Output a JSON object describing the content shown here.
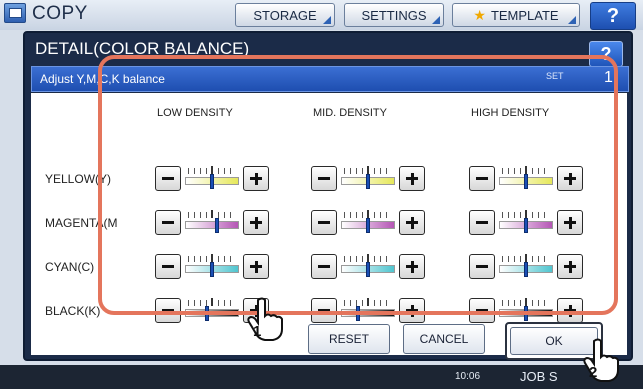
{
  "app": {
    "title": "COPY"
  },
  "top_tabs": [
    {
      "label": "STORAGE"
    },
    {
      "label": "SETTINGS"
    },
    {
      "label": "TEMPLATE"
    }
  ],
  "top_help": "?",
  "dialog": {
    "title": "DETAIL(COLOR BALANCE)",
    "help": "?",
    "subtitle": "Adjust Y,M,C,K balance",
    "set_label": "SET",
    "set_value": "1"
  },
  "columns": [
    "LOW DENSITY",
    "MID. DENSITY",
    "HIGH DENSITY"
  ],
  "rows": [
    {
      "label": "YELLOW(Y)",
      "color": "#e6e85a",
      "levels": [
        0,
        0,
        0
      ]
    },
    {
      "label": "MAGENTA(M",
      "color": "#b556b5",
      "levels": [
        1,
        0,
        0
      ]
    },
    {
      "label": "CYAN(C)",
      "color": "#4fc5cf",
      "levels": [
        0,
        0,
        0
      ]
    },
    {
      "label": "BLACK(K)",
      "color": "#111111",
      "levels": [
        -1,
        -2,
        0
      ]
    }
  ],
  "buttons": {
    "reset": "RESET",
    "cancel": "CANCEL",
    "ok": "OK"
  },
  "callouts": [
    "1",
    "2"
  ],
  "status": {
    "time": "10:06",
    "jobs": "JOB S"
  },
  "colors": {
    "highlight": "#e4755c",
    "accent": "#1e4eb0"
  }
}
